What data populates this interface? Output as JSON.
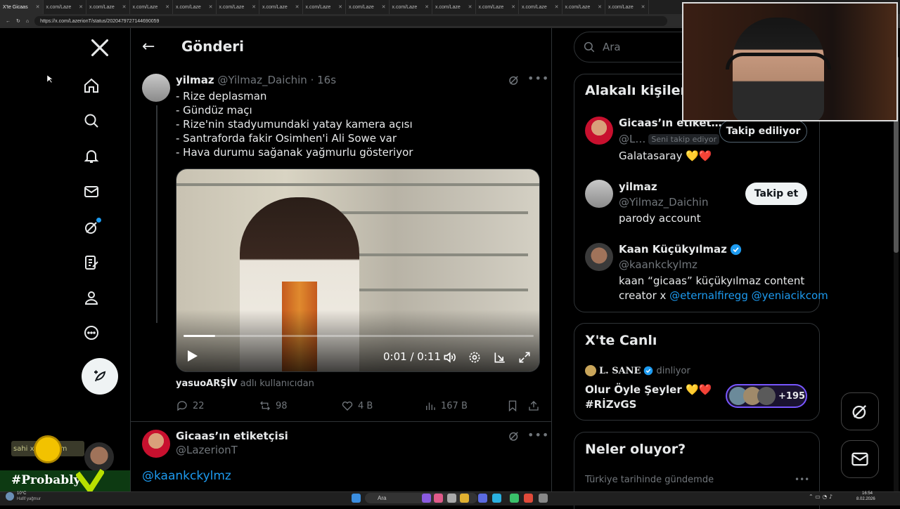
{
  "browser": {
    "active_tab": "X'te Gicaas",
    "tabs": [
      "x.com/Laze",
      "x.com/Laze",
      "x.com/Laze",
      "x.com/Laze",
      "x.com/Laze",
      "x.com/Laze",
      "x.com/Laze",
      "x.com/Laze",
      "x.com/Laze",
      "x.com/Laze",
      "x.com/Laze",
      "x.com/Laze",
      "x.com/Laze",
      "x.com/Laze",
      "x.com/Laze"
    ],
    "url": "https://x.com/LazerionT/status/2020479727144690059"
  },
  "header": {
    "title": "Gönderi"
  },
  "post": {
    "name": "yilmaz",
    "handle": "@Yilmaz_Daichin",
    "time": "· 16s",
    "lines": [
      "- Rize deplasman",
      "- Gündüz maçı",
      "- Rize'nin stadyumundaki yatay kamera açısı",
      "- Santraforda fakir Osimhen'i Ali Sowe var",
      "- Hava durumu sağanak yağmurlu gösteriyor"
    ],
    "video": {
      "time": "0:01 / 0:11",
      "progress": 0.09
    },
    "source_user": "yasuoARŞİV",
    "source_suffix": "adlı kullanıcıdan",
    "replies": "22",
    "reposts": "98",
    "likes": "4 B",
    "views": "167 B"
  },
  "reply": {
    "name": "Gicaas’ın etiketçisi",
    "handle": "@LazerionT",
    "mention": "@kaankckylmz"
  },
  "search": {
    "placeholder": "Ara"
  },
  "related": {
    "title": "Alakalı kişiler",
    "people": [
      {
        "name": "Gicaas’ın etiket…",
        "handle": "@L…",
        "badge": "Seni takip ediyor",
        "bio": "Galatasaray 💛❤️",
        "button": "Takip ediliyor"
      },
      {
        "name": "yilmaz",
        "handle": "@Yilmaz_Daichin",
        "bio": "parody account",
        "button": "Takip et"
      },
      {
        "name": "Kaan Küçükyılmaz",
        "handle": "@kaankckylmz",
        "bio_1": "kaan “gicaas” küçükyılmaz content",
        "bio_2": "creator x",
        "link_1": "@eternalfiregg",
        "link_2": "@yeniacikcom"
      }
    ]
  },
  "live": {
    "title": "X'te Canlı",
    "host": "L. SANE",
    "status": "dinliyor",
    "space_1": "Olur Öyle Şeyler 💛❤️",
    "space_2": "#RİZvGS",
    "count": "+195"
  },
  "trends": {
    "title": "Neler oluyor?",
    "subtitle": "Türkiye tarihinde gündemde"
  },
  "overlay": {
    "brand": "#Probably",
    "sponsor": "sahi x100 .com"
  },
  "taskbar": {
    "weather_temp": "10°C",
    "weather_desc": "Hafif yağmur",
    "search": "Ara",
    "clock": "16:54",
    "date": "8.02.2026"
  },
  "colors": {
    "accent": "#1d9bf0",
    "bg": "#000000",
    "border": "#2f3336",
    "muted": "#71767b",
    "live_ring": "#7856ff"
  }
}
